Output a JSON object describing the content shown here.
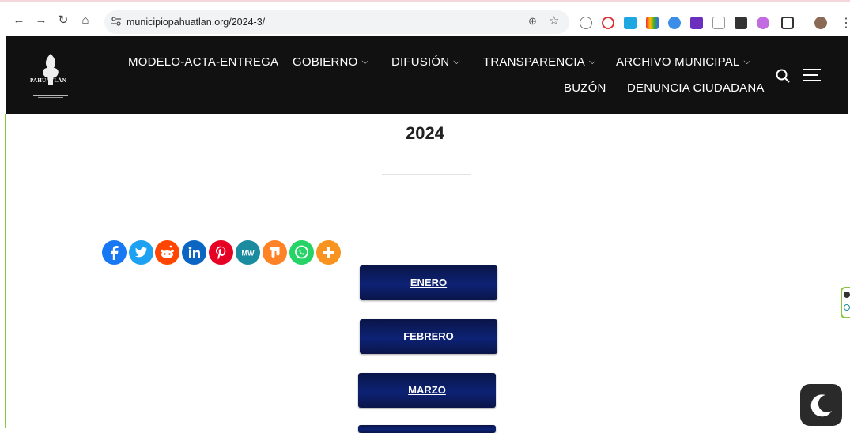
{
  "browser": {
    "url": "municipiopahuatlan.org/2024-3/",
    "nav_icons": [
      "back-arrow-icon",
      "forward-arrow-icon",
      "reload-icon",
      "home-icon"
    ],
    "omnibox_icons": [
      "site-info-icon",
      "zoom-icon",
      "bookmark-star-icon"
    ],
    "extension_icons": [
      "extension-1-icon",
      "extension-2-icon",
      "extension-3-icon",
      "extension-4-icon",
      "extension-5-icon",
      "extension-6-icon",
      "extension-7-icon",
      "extension-8-icon",
      "extension-9-icon",
      "puzzle-icon",
      "profile-avatar-icon",
      "menu-kebab-icon"
    ]
  },
  "header": {
    "logo_text": "PAHUATLÁN",
    "menu": [
      {
        "label": "MODELO-ACTA-ENTREGA",
        "has_dropdown": false
      },
      {
        "label": "GOBIERNO",
        "has_dropdown": true
      },
      {
        "label": "DIFUSIÓN",
        "has_dropdown": true
      },
      {
        "label": "TRANSPARENCIA",
        "has_dropdown": true
      },
      {
        "label": "ARCHIVO MUNICIPAL",
        "has_dropdown": true
      },
      {
        "label": "BUZÓN",
        "has_dropdown": false
      },
      {
        "label": "DENUNCIA CIUDADANA",
        "has_dropdown": false
      }
    ],
    "background": "#111111"
  },
  "main": {
    "title": "2024",
    "share_buttons": [
      {
        "name": "facebook",
        "color": "#1877f2"
      },
      {
        "name": "twitter",
        "color": "#1da1f2"
      },
      {
        "name": "reddit",
        "color": "#ff4500"
      },
      {
        "name": "linkedin",
        "color": "#0a66c2"
      },
      {
        "name": "pinterest",
        "color": "#e60023"
      },
      {
        "name": "mewe",
        "color": "#1b8ca0"
      },
      {
        "name": "mix",
        "color": "#ff8226"
      },
      {
        "name": "whatsapp",
        "color": "#25d366"
      },
      {
        "name": "more",
        "color": "#f7931e"
      }
    ],
    "months": [
      "ENERO",
      "FEBRERO",
      "MARZO"
    ],
    "button_color": "#0d2275"
  },
  "accent_green": "#8cc63f"
}
